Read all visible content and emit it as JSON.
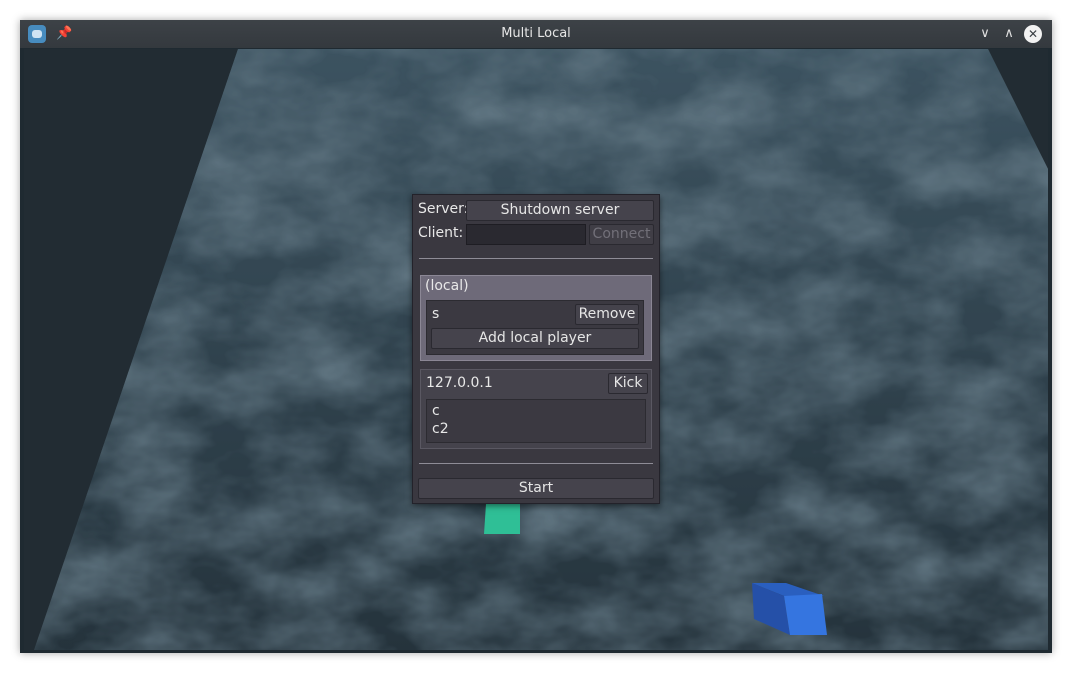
{
  "window": {
    "title": "Multi Local"
  },
  "titlebar_icons": {
    "app": "godot-icon",
    "pin": "pin-icon",
    "minimize": "chevron-down-icon",
    "maximize": "chevron-up-icon",
    "close": "close-icon"
  },
  "menu": {
    "server_label": "Server:",
    "server_button": "Shutdown server",
    "client_label": "Client:",
    "client_input_value": "",
    "connect_button": "Connect",
    "local": {
      "header": "(local)",
      "players": [
        {
          "name": "s",
          "action": "Remove"
        }
      ],
      "add_button": "Add local player"
    },
    "remote": {
      "address": "127.0.0.1",
      "kick_button": "Kick",
      "players": [
        "c",
        "c2"
      ]
    },
    "start_button": "Start"
  },
  "colors": {
    "green_cube": "#2fbf96",
    "blue_cube": "#2f6fd9",
    "panel_bg": "#3a3840",
    "local_box": "#6e6a79"
  }
}
